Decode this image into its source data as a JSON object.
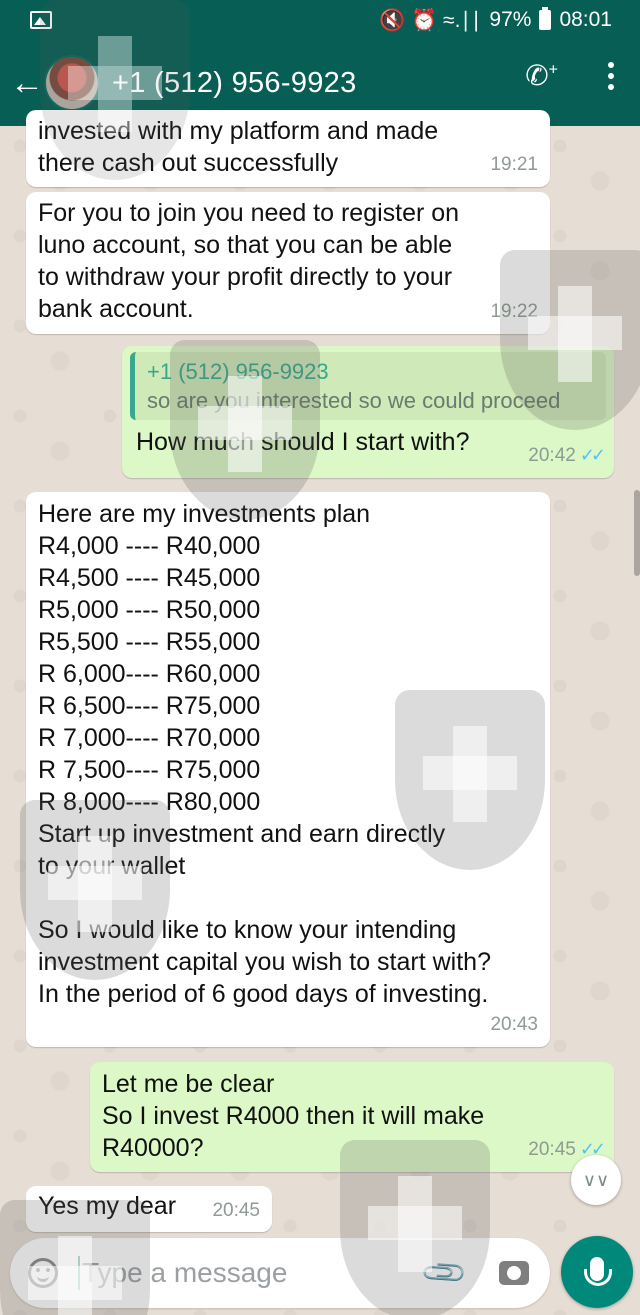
{
  "status_bar": {
    "battery": "97%",
    "time": "08:01",
    "signal_text": "⊙ ⏰ ≈ .∣∣"
  },
  "header": {
    "contact": "+1 (512) 956-9923",
    "back_icon": "arrow-left-icon",
    "call_icon": "add-call-icon",
    "menu_icon": "more-vertical-icon"
  },
  "messages": [
    {
      "direction": "in",
      "text": "invested with my platform and made\nthere cash out successfully",
      "time": "19:21"
    },
    {
      "direction": "in",
      "text": "For you to join you need to register on\nluno account, so that you can be able\nto withdraw your profit directly to your\nbank account.",
      "time": "19:22"
    },
    {
      "direction": "out",
      "quote_name": "+1 (512) 956-9923",
      "quote_text": "so are you interested so we could proceed",
      "text": "How much should I start with?",
      "time": "20:42",
      "ticks": "✓✓"
    },
    {
      "direction": "in",
      "text": "Here are my investments plan\nR4,000 ---- R40,000\nR4,500 ---- R45,000\nR5,000 ---- R50,000\nR5,500 ---- R55,000\nR 6,000---- R60,000\nR 6,500---- R75,000\nR 7,000---- R70,000\nR 7,500---- R75,000\nR 8,000---- R80,000\nStart up investment and earn directly\nto your wallet\n\nSo I would like to know your intending\ninvestment capital you wish to start with?\nIn the period of 6 good days of investing.",
      "time": "20:43"
    },
    {
      "direction": "out",
      "text": "Let me be clear\nSo I invest R4000 then it will make\nR40000?",
      "time": "20:45",
      "ticks": "✓✓"
    },
    {
      "direction": "in",
      "text": "Yes my dear",
      "time": "20:45"
    }
  ],
  "input": {
    "placeholder": "Type a message"
  },
  "colors": {
    "header": "#075e54",
    "outgoing_bubble": "#dcf8c6",
    "incoming_bubble": "#ffffff",
    "accent": "#00897b"
  }
}
